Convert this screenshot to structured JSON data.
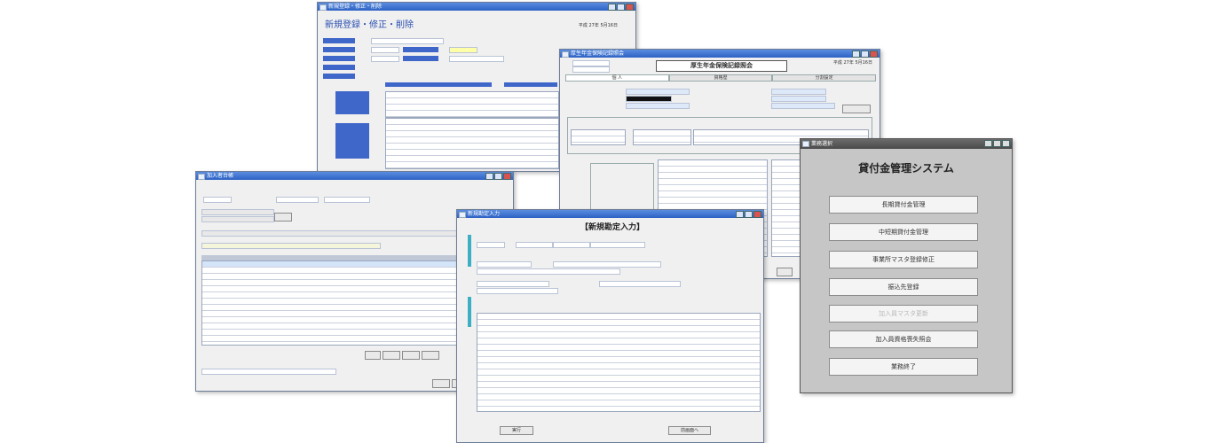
{
  "windows": {
    "registration": {
      "title": "新規登録・修正・削除",
      "heading": "新規登録・修正・削除",
      "date": "平成 27年 5月16日"
    },
    "pension": {
      "title": "厚生年金保険記録照会",
      "heading": "厚生年金保険記録照会",
      "date": "平成 27年 5月16日",
      "tabs": [
        "個 人",
        "資格歴",
        "分割設定"
      ]
    },
    "ledger": {
      "title": "加入者台帳"
    },
    "new_contract": {
      "title": "新規勘定入力",
      "heading": "【新規勘定入力】",
      "buttons": {
        "run": "実行",
        "back": "前画面へ"
      }
    },
    "menu": {
      "title": "業務選択",
      "heading": "貸付金管理システム",
      "items": [
        {
          "label": "長期貸付金管理",
          "enabled": true
        },
        {
          "label": "中短期貸付金管理",
          "enabled": true
        },
        {
          "label": "事業所マスタ登録修正",
          "enabled": true
        },
        {
          "label": "振込先登録",
          "enabled": true
        },
        {
          "label": "加入員マスタ更新",
          "enabled": false
        },
        {
          "label": "加入員資格喪失照会",
          "enabled": true
        },
        {
          "label": "業務終了",
          "enabled": true
        }
      ]
    }
  }
}
